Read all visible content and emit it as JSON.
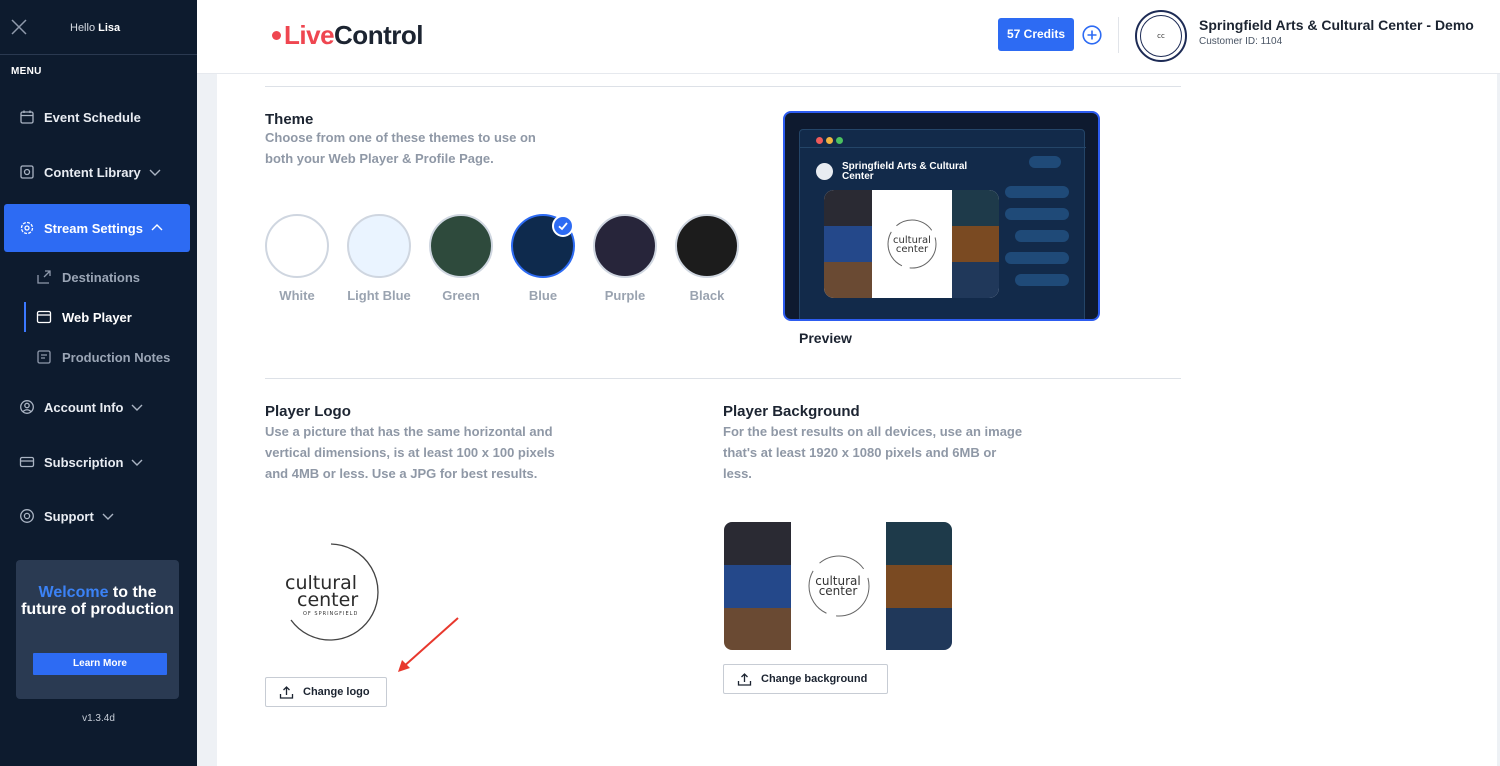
{
  "sidebar": {
    "greeting": "Hello",
    "user_name": "Lisa",
    "menu_label": "MENU",
    "items": [
      {
        "label": "Event Schedule"
      },
      {
        "label": "Content Library"
      },
      {
        "label": "Stream Settings"
      },
      {
        "label": "Account Info"
      },
      {
        "label": "Subscription"
      },
      {
        "label": "Support"
      }
    ],
    "subitems": [
      {
        "label": "Destinations"
      },
      {
        "label": "Web Player"
      },
      {
        "label": "Production Notes"
      }
    ],
    "welcome": {
      "highlight": "Welcome",
      "rest": " to the future of production",
      "button": "Learn More"
    },
    "version": "v1.3.4d"
  },
  "header": {
    "brand_live": "Live",
    "brand_control": "Control",
    "credits_label": "57 Credits",
    "org_name": "Springfield Arts & Cultural Center - Demo",
    "customer_id": "Customer ID: 1104"
  },
  "theme": {
    "title": "Theme",
    "description": "Choose from one of these themes to use on both your Web Player & Profile Page.",
    "options": [
      {
        "label": "White",
        "color": "#ffffff"
      },
      {
        "label": "Light Blue",
        "color": "#eaf4ff"
      },
      {
        "label": "Green",
        "color": "#2e4a3c"
      },
      {
        "label": "Blue",
        "color": "#0e2a4d"
      },
      {
        "label": "Purple",
        "color": "#27253a"
      },
      {
        "label": "Black",
        "color": "#1c1c1c"
      }
    ],
    "selected": "Blue",
    "preview_title": "Springfield Arts & Cultural Center",
    "preview_label": "Preview"
  },
  "player_logo": {
    "title": "Player Logo",
    "description": "Use a picture that has the same horizontal and vertical dimensions, is at least 100 x 100 pixels and 4MB or less. Use a JPG for best results.",
    "button": "Change logo",
    "logo_line1": "cultural",
    "logo_line2": "center",
    "logo_line3": "OF SPRINGFIELD"
  },
  "player_background": {
    "title": "Player Background",
    "description": "For the best results on all devices, use an image that's at least 1920 x 1080 pixels and 6MB or less.",
    "button": "Change background"
  },
  "colors": {
    "accent": "#2d6bf3",
    "sidebar_bg": "#0d1b2e",
    "brand_red": "#ef4650"
  }
}
